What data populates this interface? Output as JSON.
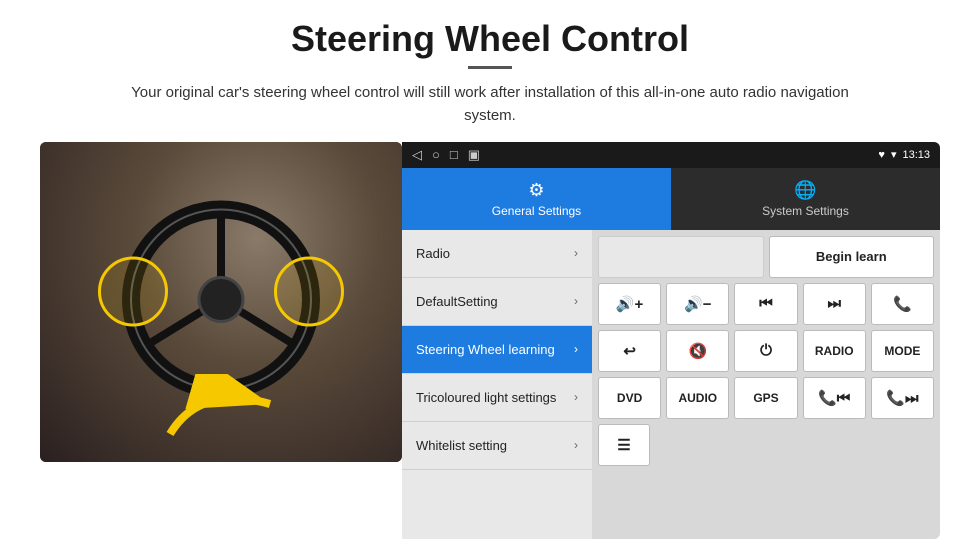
{
  "header": {
    "title": "Steering Wheel Control",
    "divider": true,
    "subtitle": "Your original car's steering wheel control will still work after installation of this all-in-one auto radio navigation system."
  },
  "statusBar": {
    "icons": [
      "◁",
      "○",
      "□",
      "▣"
    ],
    "rightIcons": "♥ ▾",
    "time": "13:13"
  },
  "tabs": {
    "general": {
      "label": "General Settings",
      "icon": "⚙"
    },
    "system": {
      "label": "System Settings",
      "icon": "🌐"
    }
  },
  "menu": {
    "items": [
      {
        "label": "Radio",
        "active": false
      },
      {
        "label": "DefaultSetting",
        "active": false
      },
      {
        "label": "Steering Wheel learning",
        "active": true
      },
      {
        "label": "Tricoloured light settings",
        "active": false
      },
      {
        "label": "Whitelist setting",
        "active": false
      }
    ]
  },
  "controls": {
    "row1": {
      "empty_label": "",
      "begin_learn": "Begin learn"
    },
    "row2": {
      "btns": [
        "🔊+",
        "🔊−",
        "⏮",
        "⏭",
        "📞"
      ]
    },
    "row3": {
      "btns": [
        "↩",
        "🔊✕",
        "⏻",
        "RADIO",
        "MODE"
      ]
    },
    "row4": {
      "btns": [
        "DVD",
        "AUDIO",
        "GPS",
        "📞⏮",
        "📞⏭"
      ]
    },
    "row5": {
      "btns": [
        "≡"
      ]
    }
  }
}
